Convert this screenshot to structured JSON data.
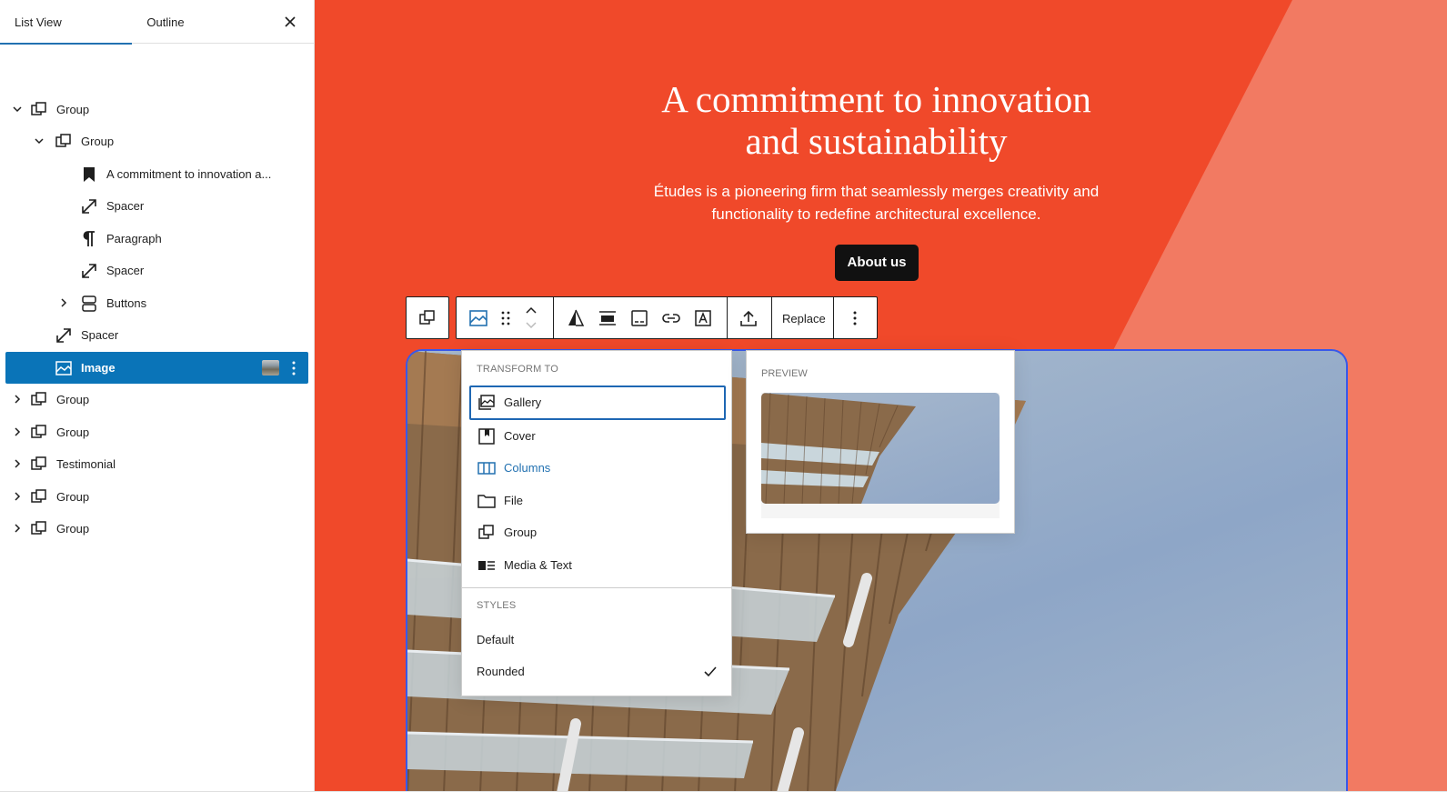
{
  "sidebar": {
    "tabs": [
      {
        "label": "List View"
      },
      {
        "label": "Outline"
      }
    ],
    "close_icon": "close-icon",
    "items": [
      {
        "label": "Group",
        "icon": "group-icon",
        "expanded": true
      },
      {
        "label": "Group",
        "icon": "group-icon",
        "expanded": true
      },
      {
        "label": "A commitment to innovation a...",
        "icon": "heading-icon"
      },
      {
        "label": "Spacer",
        "icon": "spacer-icon"
      },
      {
        "label": "Paragraph",
        "icon": "paragraph-icon"
      },
      {
        "label": "Spacer",
        "icon": "spacer-icon"
      },
      {
        "label": "Buttons",
        "icon": "buttons-icon",
        "expanded": false
      },
      {
        "label": "Spacer",
        "icon": "spacer-icon"
      },
      {
        "label": "Image",
        "icon": "image-icon",
        "selected": true
      },
      {
        "label": "Group",
        "icon": "group-icon",
        "expanded": false
      },
      {
        "label": "Group",
        "icon": "group-icon",
        "expanded": false
      },
      {
        "label": "Testimonial",
        "icon": "group-icon",
        "expanded": false
      },
      {
        "label": "Group",
        "icon": "group-icon",
        "expanded": false
      },
      {
        "label": "Group",
        "icon": "group-icon",
        "expanded": false
      }
    ]
  },
  "canvas": {
    "title_line1": "A commitment to innovation",
    "title_line2": "and sustainability",
    "body_line1": "Études is a pioneering firm that seamlessly merges creativity and",
    "body_line2": "functionality to redefine architectural excellence.",
    "button_label": "About us",
    "colors": {
      "accent": "#f0492a",
      "accent_light": "#f27a62",
      "button": "#111111",
      "selection": "#0a74b8"
    }
  },
  "toolbar": {
    "replace_label": "Replace"
  },
  "transform_menu": {
    "heading": "Transform to",
    "items": [
      {
        "label": "Gallery",
        "icon": "gallery-icon"
      },
      {
        "label": "Cover",
        "icon": "cover-icon"
      },
      {
        "label": "Columns",
        "icon": "columns-icon"
      },
      {
        "label": "File",
        "icon": "file-icon"
      },
      {
        "label": "Group",
        "icon": "group-icon"
      },
      {
        "label": "Media & Text",
        "icon": "media-text-icon"
      }
    ],
    "styles_heading": "Styles",
    "styles": [
      {
        "label": "Default"
      },
      {
        "label": "Rounded",
        "checked": true
      }
    ]
  },
  "preview": {
    "label": "PREVIEW"
  }
}
